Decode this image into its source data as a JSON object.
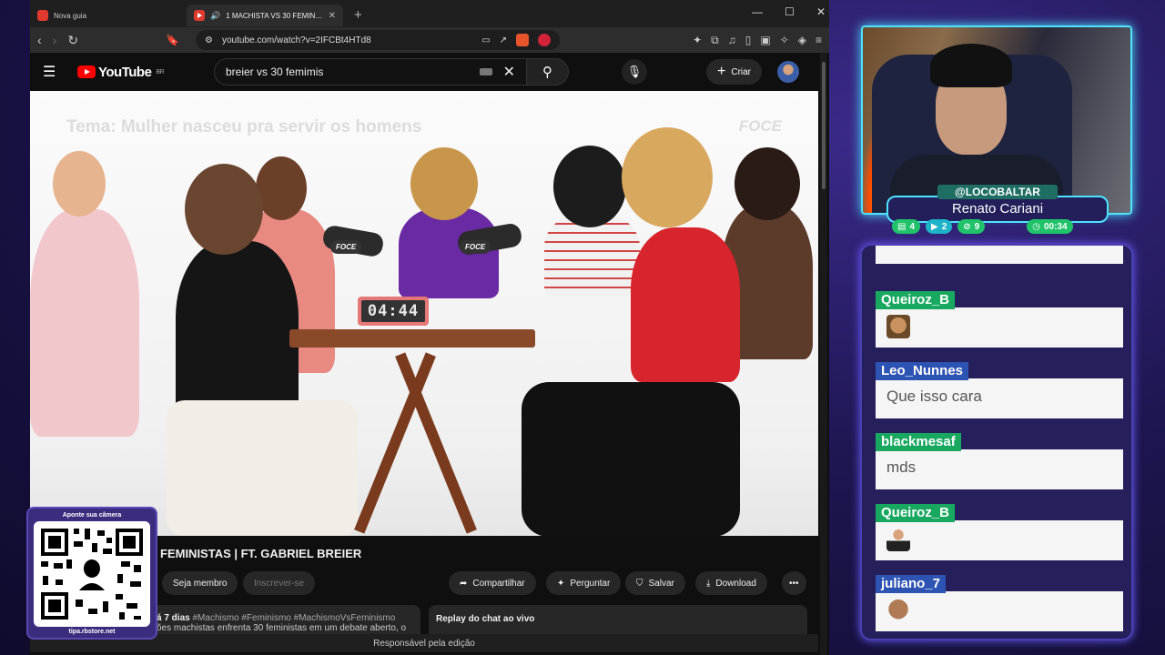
{
  "browser": {
    "tabs": [
      {
        "title": "Nova guia",
        "active": false
      },
      {
        "title": "1 MACHISTA VS 30 FEMINISTAS | FT",
        "active": true
      }
    ],
    "url": "youtube.com/watch?v=2IFCBt4HTd8"
  },
  "youtube": {
    "logo_text": "YouTube",
    "region": "BR",
    "search_value": "breier vs 30 femimis",
    "create_label": "Criar",
    "video": {
      "theme_text": "Tema: Mulher nasceu pra servir os homens",
      "watermark": "FOCE",
      "timer": "04:44",
      "mic_brand": "FOCE"
    },
    "title": "FEMINISTAS | FT. GABRIEL BREIER",
    "buttons": {
      "member": "Seja membro",
      "subscribe": "Inscrever-se",
      "share": "Compartilhar",
      "ask": "Perguntar",
      "save": "Salvar",
      "download": "Download",
      "more": "•••"
    },
    "description": {
      "date": "á 7 dias",
      "tags": "#Machismo #Feminismo #MachismoVsFeminismo",
      "text": "ões machistas enfrenta 30 feministas em um debate aberto, o"
    },
    "replay_label": "Replay do chat ao vivo",
    "footer": "Responsável pela edição"
  },
  "qr": {
    "top": "Aponte sua câmera",
    "bottom": "tipa.rbstore.net"
  },
  "stream": {
    "handle": "@LOCOBALTAR",
    "name": "Renato Cariani",
    "stats": {
      "chat": "4",
      "video": "2",
      "share": "9",
      "time": "00:34"
    }
  },
  "chat": [
    {
      "user": "Queiroz_B",
      "color": "#18a860",
      "text": "",
      "emote": "face"
    },
    {
      "user": "Leo_Nunnes",
      "color": "#2d53b3",
      "text": "Que isso cara",
      "emote": ""
    },
    {
      "user": "blackmesaf",
      "color": "#18a860",
      "text": "mds",
      "emote": ""
    },
    {
      "user": "Queiroz_B",
      "color": "#18a860",
      "text": "",
      "emote": "person"
    },
    {
      "user": "juliano_7",
      "color": "#2d53b3",
      "text": "",
      "emote": "rock"
    }
  ]
}
